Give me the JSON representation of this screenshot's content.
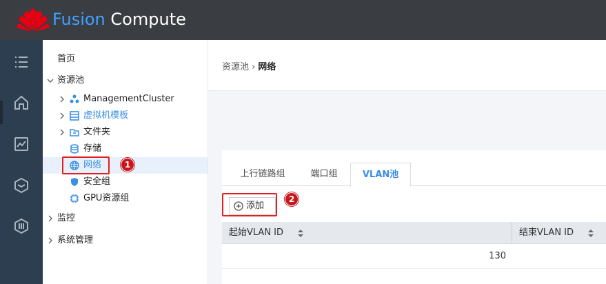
{
  "app": {
    "brand_part1": "Fusion",
    "brand_part2": "Compute"
  },
  "colors": {
    "header_bg": "#3a3d41",
    "rail_bg": "#2c3e50",
    "accent": "#3a8ee6",
    "annotation_red": "#e02020"
  },
  "rail": {
    "icons": [
      "list-icon",
      "home-icon",
      "monitor-chart-icon",
      "layers-icon",
      "hexagon-icon"
    ]
  },
  "nav": {
    "home": "首页",
    "resource_pool": "资源池",
    "management_cluster": "ManagementCluster",
    "vm_template": "虚拟机模板",
    "folder": "文件夹",
    "storage": "存储",
    "network": "网络",
    "security_group": "安全组",
    "gpu_group": "GPU资源组",
    "monitor": "监控",
    "system_mgmt": "系统管理"
  },
  "annotations": {
    "step1": "1",
    "step2": "2"
  },
  "breadcrumb": {
    "parent": "资源池",
    "separator": "›",
    "current": "网络"
  },
  "tabs": [
    {
      "label": "上行链路组"
    },
    {
      "label": "端口组"
    },
    {
      "label": "VLAN池",
      "active": true
    }
  ],
  "toolbar": {
    "add_label": "添加"
  },
  "table": {
    "columns": [
      "起始VLAN ID",
      "结束VLAN ID"
    ],
    "rows": [
      {
        "start": "130",
        "end": ""
      }
    ]
  }
}
